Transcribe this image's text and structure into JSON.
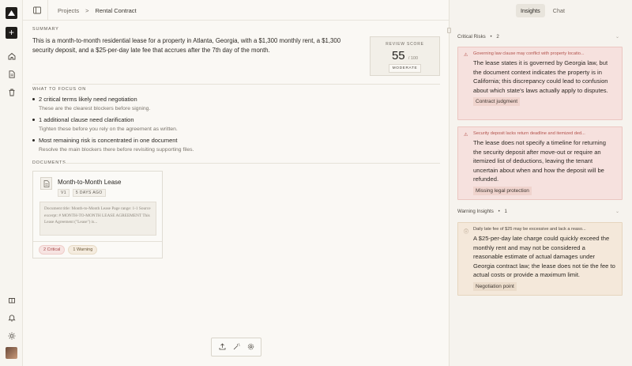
{
  "breadcrumb": {
    "root": "Projects",
    "separator": ">",
    "current": "Rental Contract"
  },
  "rail": {
    "icons": [
      "logo-icon",
      "plus-icon",
      "home-icon",
      "document-icon",
      "trash-icon",
      "gift-icon",
      "bell-icon",
      "sun-icon",
      "avatar"
    ]
  },
  "summary": {
    "label": "SUMMARY",
    "text": "This is a month-to-month residential lease for a property in Atlanta, Georgia, with a $1,300 monthly rent, a $1,300 security deposit, and a $25-per-day late fee that accrues after the 7th day of the month."
  },
  "review_score": {
    "label": "REVIEW SCORE",
    "value": "55",
    "max": "/ 100",
    "level": "MODERATE"
  },
  "focus": {
    "label": "WHAT TO FOCUS ON",
    "items": [
      {
        "title": "2 critical terms likely need negotiation",
        "sub": "These are the clearest blockers before signing."
      },
      {
        "title": "1 additional clause need clarification",
        "sub": "Tighten these before you rely on the agreement as written."
      },
      {
        "title": "Most remaining risk is concentrated in one document",
        "sub": "Resolve the main blockers there before revisiting supporting files."
      }
    ]
  },
  "documents": {
    "label": "DOCUMENTS",
    "items": [
      {
        "title": "Month-to-Month Lease",
        "version": "V1",
        "age": "5 DAYS AGO",
        "excerpt": "Document title: Month-to-Month Lease Page range: 1-1 Source excerpt: # MONTH-TO-MONTH LEASE AGREEMENT This Lease Agreement (\"Lease\") is...",
        "critical_tag": "2 Critical",
        "warning_tag": "1 Warning"
      }
    ]
  },
  "toolbar": {
    "icons": [
      "upload-icon",
      "magic-wand-icon",
      "settings-icon"
    ]
  },
  "panel": {
    "tabs": [
      {
        "label": "Insights",
        "active": true
      },
      {
        "label": "Chat",
        "active": false
      }
    ],
    "critical": {
      "label": "Critical Risks",
      "bullet": "•",
      "count": "2",
      "items": [
        {
          "head": "Governing law clause may conflict with property locatio...",
          "body": "The lease states it is governed by Georgia law, but the document context indicates the property is in California; this discrepancy could lead to confusion about which state's laws actually apply to disputes.",
          "chip": "Contract judgment"
        },
        {
          "head": "Security deposit lacks return deadline and itemized ded...",
          "body": "The lease does not specify a timeline for returning the security deposit after move-out or require an itemized list of deductions, leaving the tenant uncertain about when and how the deposit will be refunded.",
          "chip": "Missing legal protection"
        }
      ]
    },
    "warning": {
      "label": "Warning Insights",
      "bullet": "•",
      "count": "1",
      "items": [
        {
          "head": "Daily late fee of $25 may be excessive and lack a reaso...",
          "body": "A $25-per-day late charge could quickly exceed the monthly rent and may not be considered a reasonable estimate of actual damages under Georgia contract law; the lease does not tie the fee to actual costs or provide a maximum limit.",
          "chip": "Negotiation point"
        }
      ]
    }
  },
  "colors": {
    "critical_bg": "#f6e1de",
    "warning_bg": "#f4e8da",
    "critical_text": "#b2524c"
  }
}
